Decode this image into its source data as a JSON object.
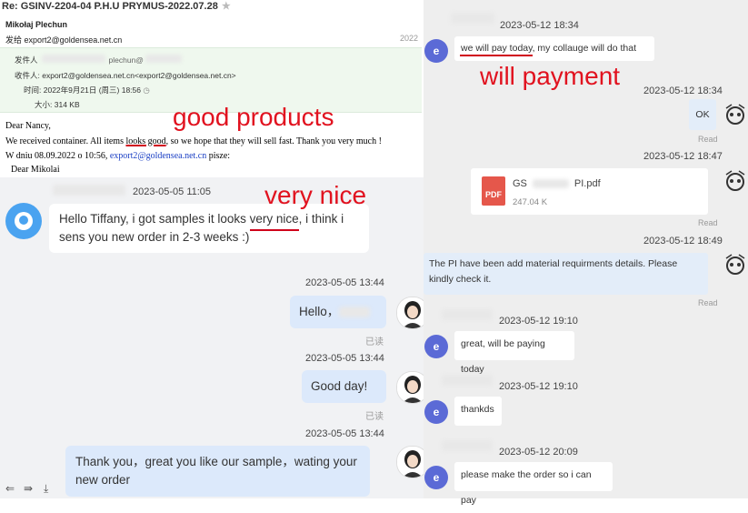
{
  "email": {
    "subject": "Re: GSINV-2204-04 P.H.U PRYMUS-2022.07.28",
    "star_icon": "star-icon",
    "sender_name": "Mikołaj Plechun",
    "sent_to_label": "发给",
    "sent_to_value": "export2@goldensea.net.cn",
    "date_truncated": "2022",
    "meta": {
      "from_label": "发件人",
      "from_value": "plechun@",
      "to_label": "收件人:",
      "to_value": "export2@goldensea.net.cn<export2@goldensea.net.cn>",
      "time_label": "时间:",
      "time_value": "2022年9月21日 (周三) 18:56",
      "size_label": "大小:",
      "size_value": "314 KB"
    },
    "body": {
      "greeting": "Dear Nancy,",
      "line1_a": "We received container. All items ",
      "line1_b": "looks good",
      "line1_c": ", so we hope that they will sell fast. Thank you very much !",
      "line2_a": "W dniu 08.09.2022 o 10:56, ",
      "line2_link": "export2@goldensea.net.cn",
      "line2_b": " pisze:",
      "line3": "Dear Mikolai"
    }
  },
  "left_chat": {
    "messages": [
      {
        "time": "2023-05-05 11:05",
        "text_a": "Hello Tiffany, i got samples it looks ",
        "text_b": "very nice",
        "text_c": ", i think i sens you new order in 2-3 weeks :)"
      },
      {
        "time": "2023-05-05 13:44",
        "text": "Hello，",
        "status": "已读"
      },
      {
        "time": "2023-05-05 13:44",
        "text": "Good day!",
        "status": "已读"
      },
      {
        "time": "2023-05-05 13:44",
        "text": "Thank you，great you like our sample，wating your new order"
      }
    ]
  },
  "right_chat": {
    "messages": [
      {
        "time": "2023-05-12 18:34",
        "text_a": "we will pay today",
        "text_b": ", my collauge will do that"
      },
      {
        "time": "2023-05-12 18:34",
        "text": "OK",
        "status": "Read"
      },
      {
        "time": "2023-05-12 18:47",
        "file_name_a": "GS",
        "file_name_b": "PI.pdf",
        "file_size": "247.04 K",
        "file_icon": "PDF",
        "status": "Read"
      },
      {
        "time": "2023-05-12 18:49",
        "text": "The PI have been add material requirments details. Please kindly check it.",
        "status": "Read"
      },
      {
        "time": "2023-05-12 19:10",
        "text": "great, will be paying today"
      },
      {
        "time": "2023-05-12 19:10",
        "text": "thankds"
      },
      {
        "time": "2023-05-12 20:09",
        "text": "please make the order so i can pay"
      }
    ],
    "avatar_letter": "e"
  },
  "annotations": {
    "good_products": "good products",
    "very_nice": "very nice",
    "will_payment": "will payment"
  },
  "colors": {
    "annotation_red": "#e1121f",
    "avatar_purple": "#5b6ad6",
    "pdf_red": "#e5574b",
    "link_blue": "#1a3fc4"
  }
}
